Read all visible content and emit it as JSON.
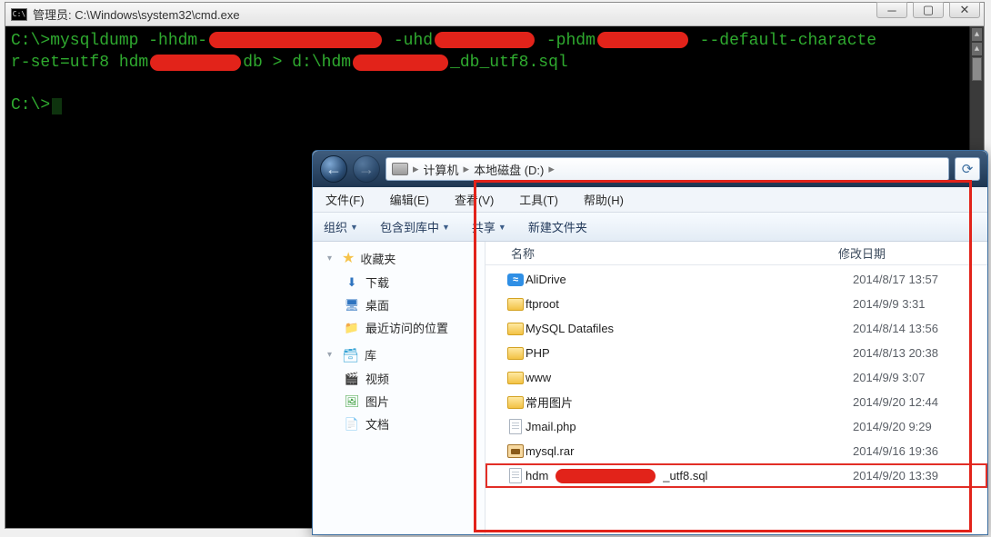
{
  "cmd": {
    "title": "管理员: C:\\Windows\\system32\\cmd.exe",
    "line1_a": "C:\\>mysqldump -hhdm-",
    "line1_b": " -uhd",
    "line1_c": " -phdm",
    "line1_d": " --default-characte",
    "line2_a": "r-set=utf8 hdm",
    "line2_b": "db > d:\\hdm",
    "line2_c": "_db_utf8.sql",
    "line3": "C:\\>"
  },
  "explorer": {
    "crumb1": "计算机",
    "crumb2": "本地磁盘 (D:)",
    "menu": {
      "file": "文件(F)",
      "edit": "编辑(E)",
      "view": "查看(V)",
      "tools": "工具(T)",
      "help": "帮助(H)"
    },
    "toolbar": {
      "org": "组织",
      "include": "包含到库中",
      "share": "共享",
      "newfolder": "新建文件夹"
    },
    "nav": {
      "favorites": "收藏夹",
      "downloads": "下载",
      "desktop": "桌面",
      "recent": "最近访问的位置",
      "libraries": "库",
      "videos": "视频",
      "pictures": "图片",
      "documents": "文档"
    },
    "cols": {
      "name": "名称",
      "date": "修改日期"
    },
    "rows": [
      {
        "icon": "blue",
        "name": "AliDrive",
        "date": "2014/8/17 13:57"
      },
      {
        "icon": "folder",
        "name": "ftproot",
        "date": "2014/9/9 3:31"
      },
      {
        "icon": "folder",
        "name": "MySQL Datafiles",
        "date": "2014/8/14 13:56"
      },
      {
        "icon": "folder",
        "name": "PHP",
        "date": "2014/8/13 20:38"
      },
      {
        "icon": "folder",
        "name": "www",
        "date": "2014/9/9 3:07"
      },
      {
        "icon": "folder",
        "name": "常用图片",
        "date": "2014/9/20 12:44"
      },
      {
        "icon": "file",
        "name": "Jmail.php",
        "date": "2014/9/20 9:29"
      },
      {
        "icon": "rar",
        "name": "mysql.rar",
        "date": "2014/9/16 19:36"
      },
      {
        "icon": "file",
        "name_a": "hdm",
        "name_b": "_utf8.sql",
        "date": "2014/9/20 13:39",
        "sel": true
      }
    ]
  }
}
